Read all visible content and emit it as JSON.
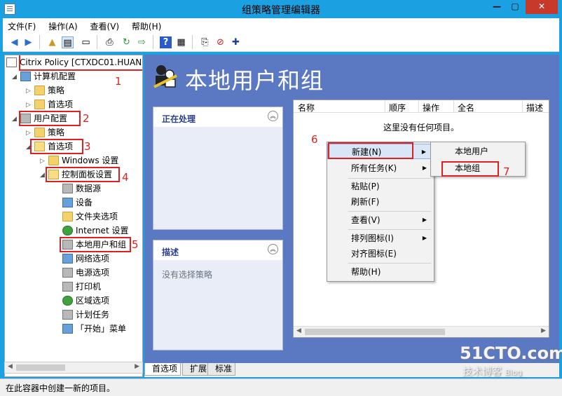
{
  "window": {
    "title": "组策略管理编辑器"
  },
  "menubar": [
    "文件(F)",
    "操作(A)",
    "查看(V)",
    "帮助(H)"
  ],
  "tree": {
    "root": "Citrix Policy [CTXDC01.HUAN",
    "items": [
      {
        "label": "计算机配置"
      },
      {
        "label": "策略"
      },
      {
        "label": "首选项"
      },
      {
        "label": "用户配置"
      },
      {
        "label": "策略"
      },
      {
        "label": "首选项"
      },
      {
        "label": "Windows 设置"
      },
      {
        "label": "控制面板设置"
      },
      {
        "label": "数据源"
      },
      {
        "label": "设备"
      },
      {
        "label": "文件夹选项"
      },
      {
        "label": "Internet 设置"
      },
      {
        "label": "本地用户和组"
      },
      {
        "label": "网络选项"
      },
      {
        "label": "电源选项"
      },
      {
        "label": "打印机"
      },
      {
        "label": "区域选项"
      },
      {
        "label": "计划任务"
      },
      {
        "label": "「开始」菜单"
      }
    ]
  },
  "annotations": [
    "1",
    "2",
    "3",
    "4",
    "5",
    "6",
    "7"
  ],
  "header": {
    "title": "本地用户和组"
  },
  "panels": {
    "processing": {
      "title": "正在处理"
    },
    "description": {
      "title": "描述",
      "body": "没有选择策略"
    }
  },
  "listview": {
    "columns": [
      "名称",
      "顺序",
      "操作",
      "全名",
      "描述"
    ],
    "empty_text": "这里没有任何项目。"
  },
  "context_menu": {
    "items": [
      "新建(N)",
      "所有任务(K)",
      "粘贴(P)",
      "刷新(F)",
      "查看(V)",
      "排列图标(I)",
      "对齐图标(E)",
      "帮助(H)"
    ]
  },
  "submenu": {
    "items": [
      "本地用户",
      "本地组"
    ]
  },
  "tabs": [
    "首选项",
    "扩展",
    "标准"
  ],
  "statusbar": {
    "text": "在此容器中创建一新的项目。"
  },
  "watermark": {
    "logo": "51CTO.com",
    "subtitle": "技术博客",
    "sub2": "Blog"
  },
  "colors": {
    "titlebar": "#1ba1e2",
    "rightpane": "#5b79c3",
    "highlight": "#e02020"
  }
}
